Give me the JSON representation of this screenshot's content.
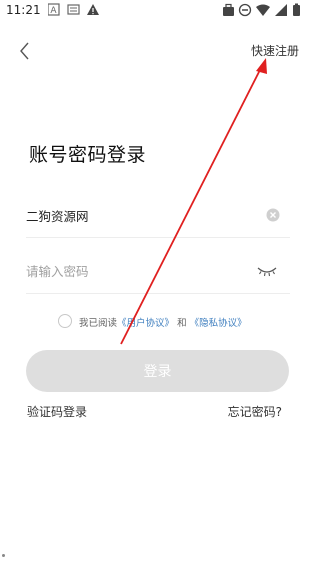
{
  "status_bar": {
    "time": "11:21",
    "left_icons": [
      "app-a-icon",
      "media-icon",
      "warning-icon"
    ],
    "right_icons": [
      "briefcase-icon",
      "do-not-disturb-icon",
      "wifi-icon",
      "signal-icon",
      "battery-icon"
    ]
  },
  "header": {
    "back_icon": "chevron-left-icon",
    "register_label": "快速注册"
  },
  "title": "账号密码登录",
  "username": {
    "value": "二狗资源网",
    "clear_icon": "clear-circle-icon"
  },
  "password": {
    "value": "",
    "placeholder": "请输入密码",
    "toggle_icon": "eye-closed-icon"
  },
  "agreement": {
    "prefix": "我已阅读",
    "user_agreement": "《用户协议》",
    "and": "和",
    "privacy_policy": "《隐私协议》",
    "checked": false,
    "link_color": "#3f7fbf"
  },
  "login_button_label": "登录",
  "footer": {
    "sms_login": "验证码登录",
    "forgot_password": "忘记密码?"
  },
  "annotation": {
    "arrow_color": "#e02020"
  }
}
